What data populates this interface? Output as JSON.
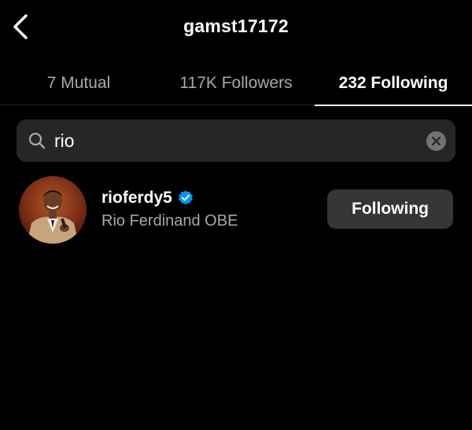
{
  "header": {
    "title": "gamst17172",
    "back_icon": "chevron-left-icon"
  },
  "tabs": [
    {
      "label": "7 Mutual",
      "active": false
    },
    {
      "label": "117K Followers",
      "active": false
    },
    {
      "label": "232 Following",
      "active": true
    }
  ],
  "search": {
    "value": "rio",
    "search_icon": "search-icon",
    "clear_icon": "clear-icon"
  },
  "results": [
    {
      "username": "rioferdy5",
      "full_name": "Rio Ferdinand OBE",
      "verified": true,
      "button_label": "Following"
    }
  ],
  "colors": {
    "background": "#000000",
    "surface": "#262626",
    "button": "#363636",
    "secondary_text": "#a8a8a8",
    "verified_blue": "#0095f6"
  }
}
